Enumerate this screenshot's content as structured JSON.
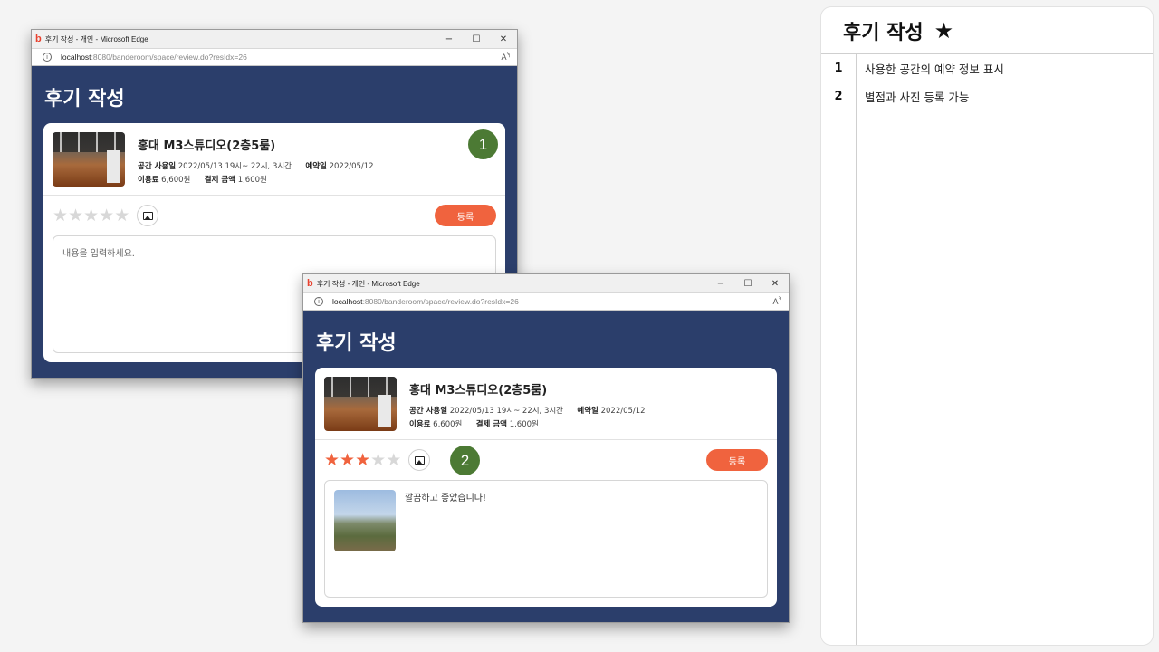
{
  "window1": {
    "title": "후기 작성 - 개인 - Microsoft Edge",
    "url_host": "localhost",
    "url_rest": ":8080/banderoom/space/review.do?resIdx=26",
    "page_title": "후기 작성",
    "space_name": "홍대 M3스튜디오(2층5룸)",
    "use_label": "공간 사용일",
    "use_value": "2022/05/13 19시~ 22시, 3시간",
    "reserve_label": "예약일",
    "reserve_value": "2022/05/12",
    "fee_label": "이용료",
    "fee_value": "6,600원",
    "pay_label": "결제 금액",
    "pay_value": "1,600원",
    "submit_label": "등록",
    "placeholder": "내용을 입력하세요.",
    "rating": 0,
    "badge": "1"
  },
  "window2": {
    "title": "후기 작성 - 개인 - Microsoft Edge",
    "url_host": "localhost",
    "url_rest": ":8080/banderoom/space/review.do?resIdx=26",
    "page_title": "후기 작성",
    "space_name": "홍대 M3스튜디오(2층5룸)",
    "use_label": "공간 사용일",
    "use_value": "2022/05/13 19시~ 22시, 3시간",
    "reserve_label": "예약일",
    "reserve_value": "2022/05/12",
    "fee_label": "이용료",
    "fee_value": "6,600원",
    "pay_label": "결제 금액",
    "pay_value": "1,600원",
    "submit_label": "등록",
    "review_text": "깔끔하고 좋았습니다!",
    "rating": 3,
    "badge": "2"
  },
  "window_controls": {
    "minimize": "−",
    "maximize": "☐",
    "close": "✕"
  },
  "icons": {
    "star": "star-icon",
    "photo": "image-icon",
    "info": "info-icon",
    "read_aloud": "read-aloud-icon"
  },
  "colors": {
    "page_bg": "#2b3e6b",
    "accent": "#f0633e",
    "badge": "#4c7a34"
  },
  "panel": {
    "title": "후기 작성",
    "notes": [
      {
        "num": "1",
        "text": "사용한 공간의 예약 정보 표시"
      },
      {
        "num": "2",
        "text": "별점과 사진 등록 가능"
      }
    ]
  }
}
